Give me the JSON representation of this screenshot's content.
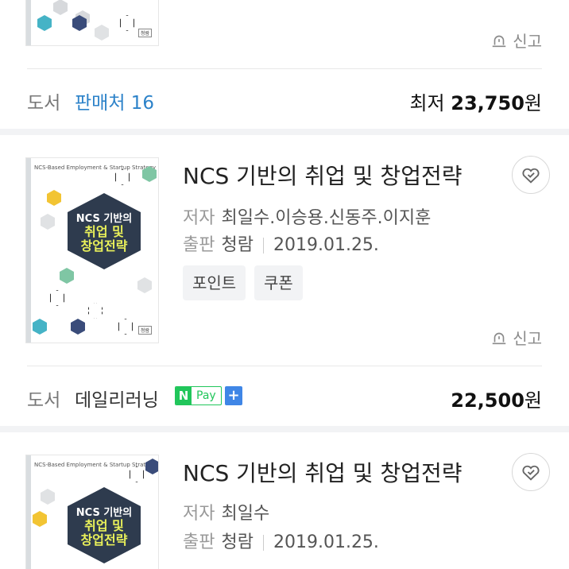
{
  "colors": {
    "seller_link": "#2c82c9",
    "npay_green": "#21c65b",
    "npay_plus_blue": "#3f86e6",
    "cover_panel": "#2e3b4e",
    "cover_title_accent": "#e9f05a"
  },
  "report_label": "신고",
  "listing_summary": {
    "category": "도서",
    "seller_count_text": "판매처 16",
    "price_prefix": "최저",
    "price_value": "23,750",
    "price_unit": "원"
  },
  "products": [
    {
      "title": "NCS 기반의 취업 및 창업전략",
      "author_label": "저자",
      "author": "최일수.이승용.신동주.이지훈",
      "publisher_label": "출판",
      "publisher": "청람",
      "date": "2019.01.25.",
      "tags": [
        "포인트",
        "쿠폰"
      ],
      "cover": {
        "subtitle": "NCS-Based Employment & Startup Strategy",
        "title_line1": "NCS 기반의",
        "title_line2": "취업 및",
        "title_line3": "창업전략",
        "publisher_mark": "청람"
      },
      "seller_row": {
        "category": "도서",
        "seller": "데일리러닝",
        "npay_n": "N",
        "npay_text": "Pay",
        "npay_plus": "+",
        "price_value": "22,500",
        "price_unit": "원"
      }
    },
    {
      "title": "NCS 기반의 취업 및 창업전략",
      "author_label": "저자",
      "author": "최일수",
      "publisher_label": "출판",
      "publisher": "청람",
      "date": "2019.01.25.",
      "cover": {
        "subtitle": "NCS-Based Employment & Startup Strategy",
        "title_line1": "NCS 기반의",
        "title_line2": "취업 및",
        "title_line3": "창업전략"
      }
    }
  ]
}
